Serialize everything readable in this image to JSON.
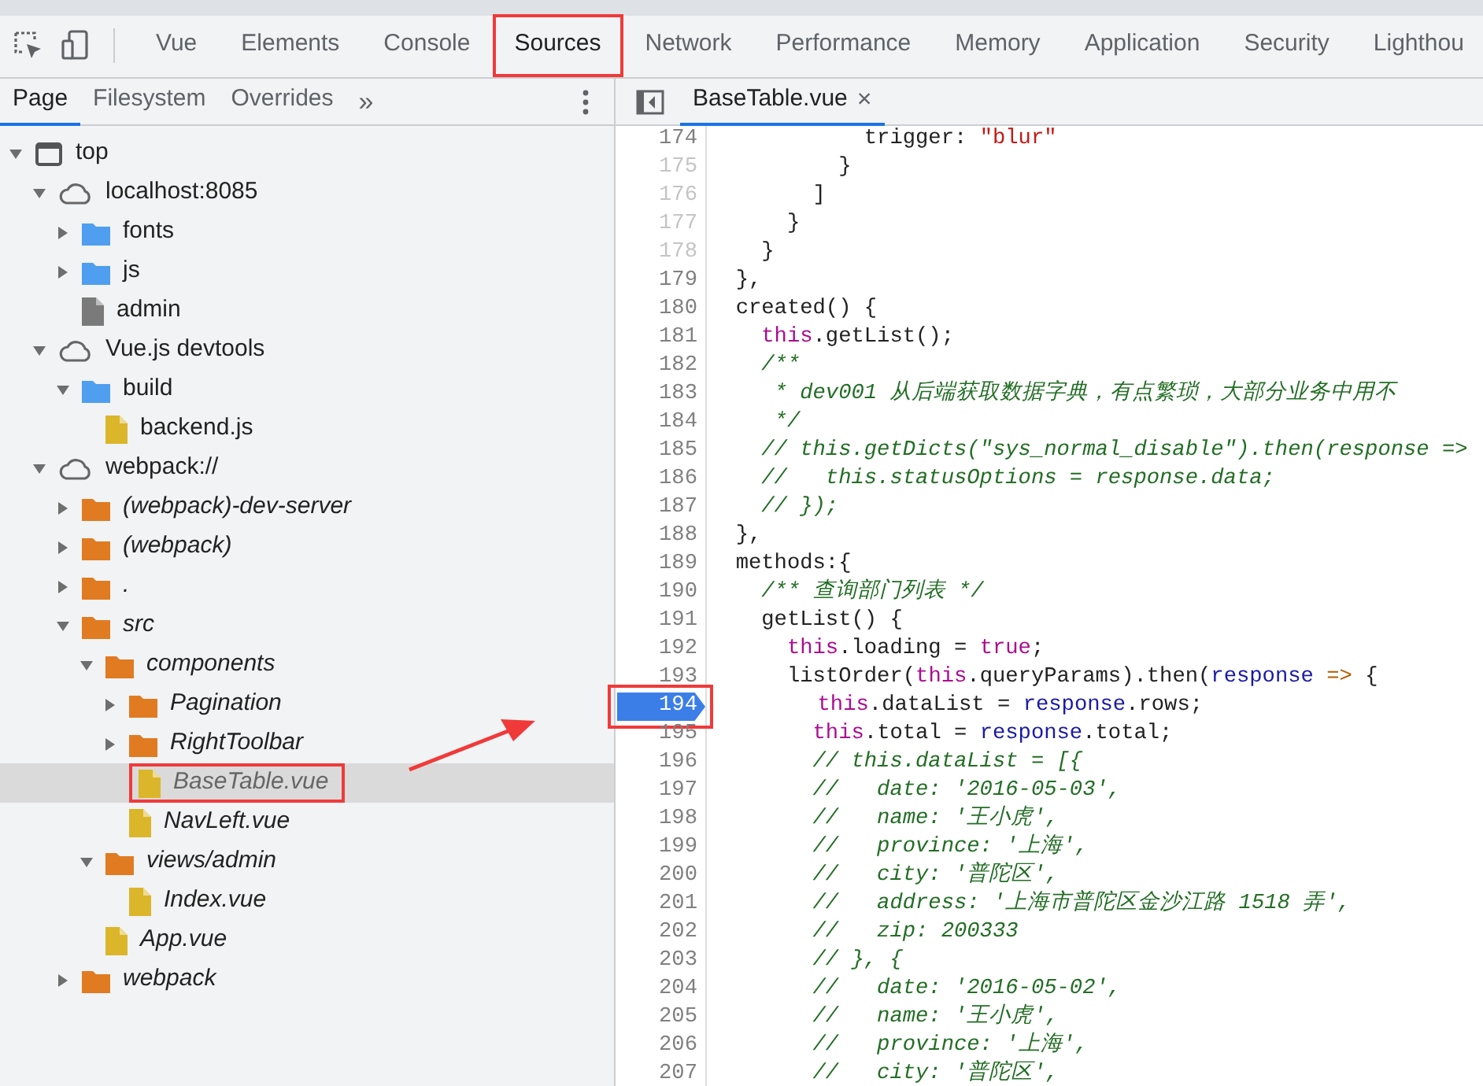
{
  "toolbar": {
    "tabs": [
      {
        "label": "Vue",
        "selected": false,
        "annotated": false
      },
      {
        "label": "Elements",
        "selected": false,
        "annotated": false
      },
      {
        "label": "Console",
        "selected": false,
        "annotated": false
      },
      {
        "label": "Sources",
        "selected": true,
        "annotated": true
      },
      {
        "label": "Network",
        "selected": false,
        "annotated": false
      },
      {
        "label": "Performance",
        "selected": false,
        "annotated": false
      },
      {
        "label": "Memory",
        "selected": false,
        "annotated": false
      },
      {
        "label": "Application",
        "selected": false,
        "annotated": false
      },
      {
        "label": "Security",
        "selected": false,
        "annotated": false
      },
      {
        "label": "Lighthou",
        "selected": false,
        "annotated": false
      }
    ]
  },
  "navigator": {
    "tabs": [
      {
        "label": "Page",
        "selected": true
      },
      {
        "label": "Filesystem",
        "selected": false
      },
      {
        "label": "Overrides",
        "selected": false
      }
    ],
    "more": "»",
    "tree": [
      {
        "kind": "frame",
        "label": "top",
        "expanded": true,
        "children": [
          {
            "kind": "origin",
            "label": "localhost:8085",
            "expanded": true,
            "children": [
              {
                "kind": "folder",
                "label": "fonts",
                "color": "#4f9ef0",
                "mapped": false,
                "expanded": false
              },
              {
                "kind": "folder",
                "label": "js",
                "color": "#4f9ef0",
                "mapped": false,
                "expanded": false
              },
              {
                "kind": "file",
                "label": "admin",
                "color": "#7a7a7a",
                "mapped": false,
                "selected": false,
                "annotated": false
              }
            ]
          },
          {
            "kind": "origin",
            "label": "Vue.js devtools",
            "expanded": true,
            "children": [
              {
                "kind": "folder",
                "label": "build",
                "color": "#4f9ef0",
                "mapped": false,
                "expanded": true,
                "children": [
                  {
                    "kind": "file",
                    "label": "backend.js",
                    "color": "#dbb62a",
                    "mapped": false,
                    "selected": false,
                    "annotated": false
                  }
                ]
              }
            ]
          },
          {
            "kind": "origin",
            "label": "webpack://",
            "expanded": true,
            "children": [
              {
                "kind": "folder",
                "label": "(webpack)-dev-server",
                "color": "#e07b22",
                "mapped": true,
                "expanded": false
              },
              {
                "kind": "folder",
                "label": "(webpack)",
                "color": "#e07b22",
                "mapped": true,
                "expanded": false
              },
              {
                "kind": "folder",
                "label": ".",
                "color": "#e07b22",
                "mapped": true,
                "expanded": false
              },
              {
                "kind": "folder",
                "label": "src",
                "color": "#e07b22",
                "mapped": true,
                "expanded": true,
                "children": [
                  {
                    "kind": "folder",
                    "label": "components",
                    "color": "#e07b22",
                    "mapped": true,
                    "expanded": true,
                    "children": [
                      {
                        "kind": "folder",
                        "label": "Pagination",
                        "color": "#e07b22",
                        "mapped": true,
                        "expanded": false
                      },
                      {
                        "kind": "folder",
                        "label": "RightToolbar",
                        "color": "#e07b22",
                        "mapped": true,
                        "expanded": false
                      },
                      {
                        "kind": "file",
                        "label": "BaseTable.vue",
                        "color": "#dbb62a",
                        "mapped": true,
                        "selected": true,
                        "annotated": true
                      },
                      {
                        "kind": "file",
                        "label": "NavLeft.vue",
                        "color": "#dbb62a",
                        "mapped": true,
                        "selected": false,
                        "annotated": false
                      }
                    ]
                  },
                  {
                    "kind": "folder",
                    "label": "views/admin",
                    "color": "#e07b22",
                    "mapped": true,
                    "expanded": true,
                    "children": [
                      {
                        "kind": "file",
                        "label": "Index.vue",
                        "color": "#dbb62a",
                        "mapped": true,
                        "selected": false,
                        "annotated": false
                      }
                    ]
                  },
                  {
                    "kind": "file",
                    "label": "App.vue",
                    "color": "#dbb62a",
                    "mapped": true,
                    "selected": false,
                    "annotated": false
                  }
                ]
              },
              {
                "kind": "folder",
                "label": "webpack",
                "color": "#e07b22",
                "mapped": true,
                "expanded": false
              }
            ]
          }
        ]
      }
    ]
  },
  "editor": {
    "tabs": [
      {
        "label": "BaseTable.vue",
        "selected": true,
        "close": "×"
      }
    ],
    "lines": [
      {
        "number": "174",
        "breakpoint": false,
        "annotated": false,
        "executable": true,
        "tokens": [
          {
            "kind": "plain",
            "text": "            trigger: "
          },
          {
            "kind": "string",
            "text": "\"blur\""
          }
        ]
      },
      {
        "number": "175",
        "breakpoint": false,
        "annotated": false,
        "executable": false,
        "tokens": [
          {
            "kind": "plain",
            "text": "          }"
          }
        ]
      },
      {
        "number": "176",
        "breakpoint": false,
        "annotated": false,
        "executable": false,
        "tokens": [
          {
            "kind": "plain",
            "text": "        ]"
          }
        ]
      },
      {
        "number": "177",
        "breakpoint": false,
        "annotated": false,
        "executable": false,
        "tokens": [
          {
            "kind": "plain",
            "text": "      }"
          }
        ]
      },
      {
        "number": "178",
        "breakpoint": false,
        "annotated": false,
        "executable": false,
        "tokens": [
          {
            "kind": "plain",
            "text": "    }"
          }
        ]
      },
      {
        "number": "179",
        "breakpoint": false,
        "annotated": false,
        "executable": true,
        "tokens": [
          {
            "kind": "plain",
            "text": "  },"
          }
        ]
      },
      {
        "number": "180",
        "breakpoint": false,
        "annotated": false,
        "executable": true,
        "tokens": [
          {
            "kind": "plain",
            "text": "  created() {"
          }
        ]
      },
      {
        "number": "181",
        "breakpoint": false,
        "annotated": false,
        "executable": true,
        "tokens": [
          {
            "kind": "keyword",
            "text": "    this"
          },
          {
            "kind": "plain",
            "text": ".getList();"
          }
        ]
      },
      {
        "number": "182",
        "breakpoint": false,
        "annotated": false,
        "executable": true,
        "tokens": [
          {
            "kind": "comment",
            "text": "    /**"
          }
        ]
      },
      {
        "number": "183",
        "breakpoint": false,
        "annotated": false,
        "executable": true,
        "tokens": [
          {
            "kind": "comment",
            "text": "     * dev001 从后端获取数据字典，有点繁琐，大部分业务中用不"
          }
        ]
      },
      {
        "number": "184",
        "breakpoint": false,
        "annotated": false,
        "executable": true,
        "tokens": [
          {
            "kind": "comment",
            "text": "     */"
          }
        ]
      },
      {
        "number": "185",
        "breakpoint": false,
        "annotated": false,
        "executable": true,
        "tokens": [
          {
            "kind": "comment",
            "text": "    // this.getDicts(\"sys_normal_disable\").then(response =>"
          }
        ]
      },
      {
        "number": "186",
        "breakpoint": false,
        "annotated": false,
        "executable": true,
        "tokens": [
          {
            "kind": "comment",
            "text": "    //   this.statusOptions = response.data;"
          }
        ]
      },
      {
        "number": "187",
        "breakpoint": false,
        "annotated": false,
        "executable": true,
        "tokens": [
          {
            "kind": "comment",
            "text": "    // });"
          }
        ]
      },
      {
        "number": "188",
        "breakpoint": false,
        "annotated": false,
        "executable": true,
        "tokens": [
          {
            "kind": "plain",
            "text": "  },"
          }
        ]
      },
      {
        "number": "189",
        "breakpoint": false,
        "annotated": false,
        "executable": true,
        "tokens": [
          {
            "kind": "plain",
            "text": "  methods:{"
          }
        ]
      },
      {
        "number": "190",
        "breakpoint": false,
        "annotated": false,
        "executable": true,
        "tokens": [
          {
            "kind": "comment",
            "text": "    /** 查询部门列表 */"
          }
        ]
      },
      {
        "number": "191",
        "breakpoint": false,
        "annotated": false,
        "executable": true,
        "tokens": [
          {
            "kind": "plain",
            "text": "    getList() {"
          }
        ]
      },
      {
        "number": "192",
        "breakpoint": false,
        "annotated": false,
        "executable": true,
        "tokens": [
          {
            "kind": "keyword",
            "text": "      this"
          },
          {
            "kind": "plain",
            "text": ".loading = "
          },
          {
            "kind": "keyword",
            "text": "true"
          },
          {
            "kind": "plain",
            "text": ";"
          }
        ]
      },
      {
        "number": "193",
        "breakpoint": false,
        "annotated": false,
        "executable": true,
        "tokens": [
          {
            "kind": "plain",
            "text": "      listOrder("
          },
          {
            "kind": "keyword",
            "text": "this"
          },
          {
            "kind": "plain",
            "text": ".queryParams).then("
          },
          {
            "kind": "param",
            "text": "response"
          },
          {
            "kind": "operator",
            "text": " =>"
          },
          {
            "kind": "plain",
            "text": " {"
          }
        ]
      },
      {
        "number": "194",
        "breakpoint": true,
        "annotated": true,
        "executable": true,
        "tokens": [
          {
            "kind": "keyword",
            "text": "        this"
          },
          {
            "kind": "plain",
            "text": ".dataList = "
          },
          {
            "kind": "param",
            "text": "response"
          },
          {
            "kind": "plain",
            "text": ".rows;"
          }
        ]
      },
      {
        "number": "195",
        "breakpoint": false,
        "annotated": false,
        "executable": true,
        "tokens": [
          {
            "kind": "keyword",
            "text": "        this"
          },
          {
            "kind": "plain",
            "text": ".total = "
          },
          {
            "kind": "param",
            "text": "response"
          },
          {
            "kind": "plain",
            "text": ".total;"
          }
        ]
      },
      {
        "number": "196",
        "breakpoint": false,
        "annotated": false,
        "executable": true,
        "tokens": [
          {
            "kind": "comment",
            "text": "        // this.dataList = [{"
          }
        ]
      },
      {
        "number": "197",
        "breakpoint": false,
        "annotated": false,
        "executable": true,
        "tokens": [
          {
            "kind": "comment",
            "text": "        //   date: '2016-05-03',"
          }
        ]
      },
      {
        "number": "198",
        "breakpoint": false,
        "annotated": false,
        "executable": true,
        "tokens": [
          {
            "kind": "comment",
            "text": "        //   name: '王小虎',"
          }
        ]
      },
      {
        "number": "199",
        "breakpoint": false,
        "annotated": false,
        "executable": true,
        "tokens": [
          {
            "kind": "comment",
            "text": "        //   province: '上海',"
          }
        ]
      },
      {
        "number": "200",
        "breakpoint": false,
        "annotated": false,
        "executable": true,
        "tokens": [
          {
            "kind": "comment",
            "text": "        //   city: '普陀区',"
          }
        ]
      },
      {
        "number": "201",
        "breakpoint": false,
        "annotated": false,
        "executable": true,
        "tokens": [
          {
            "kind": "comment",
            "text": "        //   address: '上海市普陀区金沙江路 1518 弄',"
          }
        ]
      },
      {
        "number": "202",
        "breakpoint": false,
        "annotated": false,
        "executable": true,
        "tokens": [
          {
            "kind": "comment",
            "text": "        //   zip: 200333"
          }
        ]
      },
      {
        "number": "203",
        "breakpoint": false,
        "annotated": false,
        "executable": true,
        "tokens": [
          {
            "kind": "comment",
            "text": "        // }, {"
          }
        ]
      },
      {
        "number": "204",
        "breakpoint": false,
        "annotated": false,
        "executable": true,
        "tokens": [
          {
            "kind": "comment",
            "text": "        //   date: '2016-05-02',"
          }
        ]
      },
      {
        "number": "205",
        "breakpoint": false,
        "annotated": false,
        "executable": true,
        "tokens": [
          {
            "kind": "comment",
            "text": "        //   name: '王小虎',"
          }
        ]
      },
      {
        "number": "206",
        "breakpoint": false,
        "annotated": false,
        "executable": true,
        "tokens": [
          {
            "kind": "comment",
            "text": "        //   province: '上海',"
          }
        ]
      },
      {
        "number": "207",
        "breakpoint": false,
        "annotated": false,
        "executable": true,
        "tokens": [
          {
            "kind": "comment",
            "text": "        //   city: '普陀区',"
          }
        ]
      }
    ]
  }
}
